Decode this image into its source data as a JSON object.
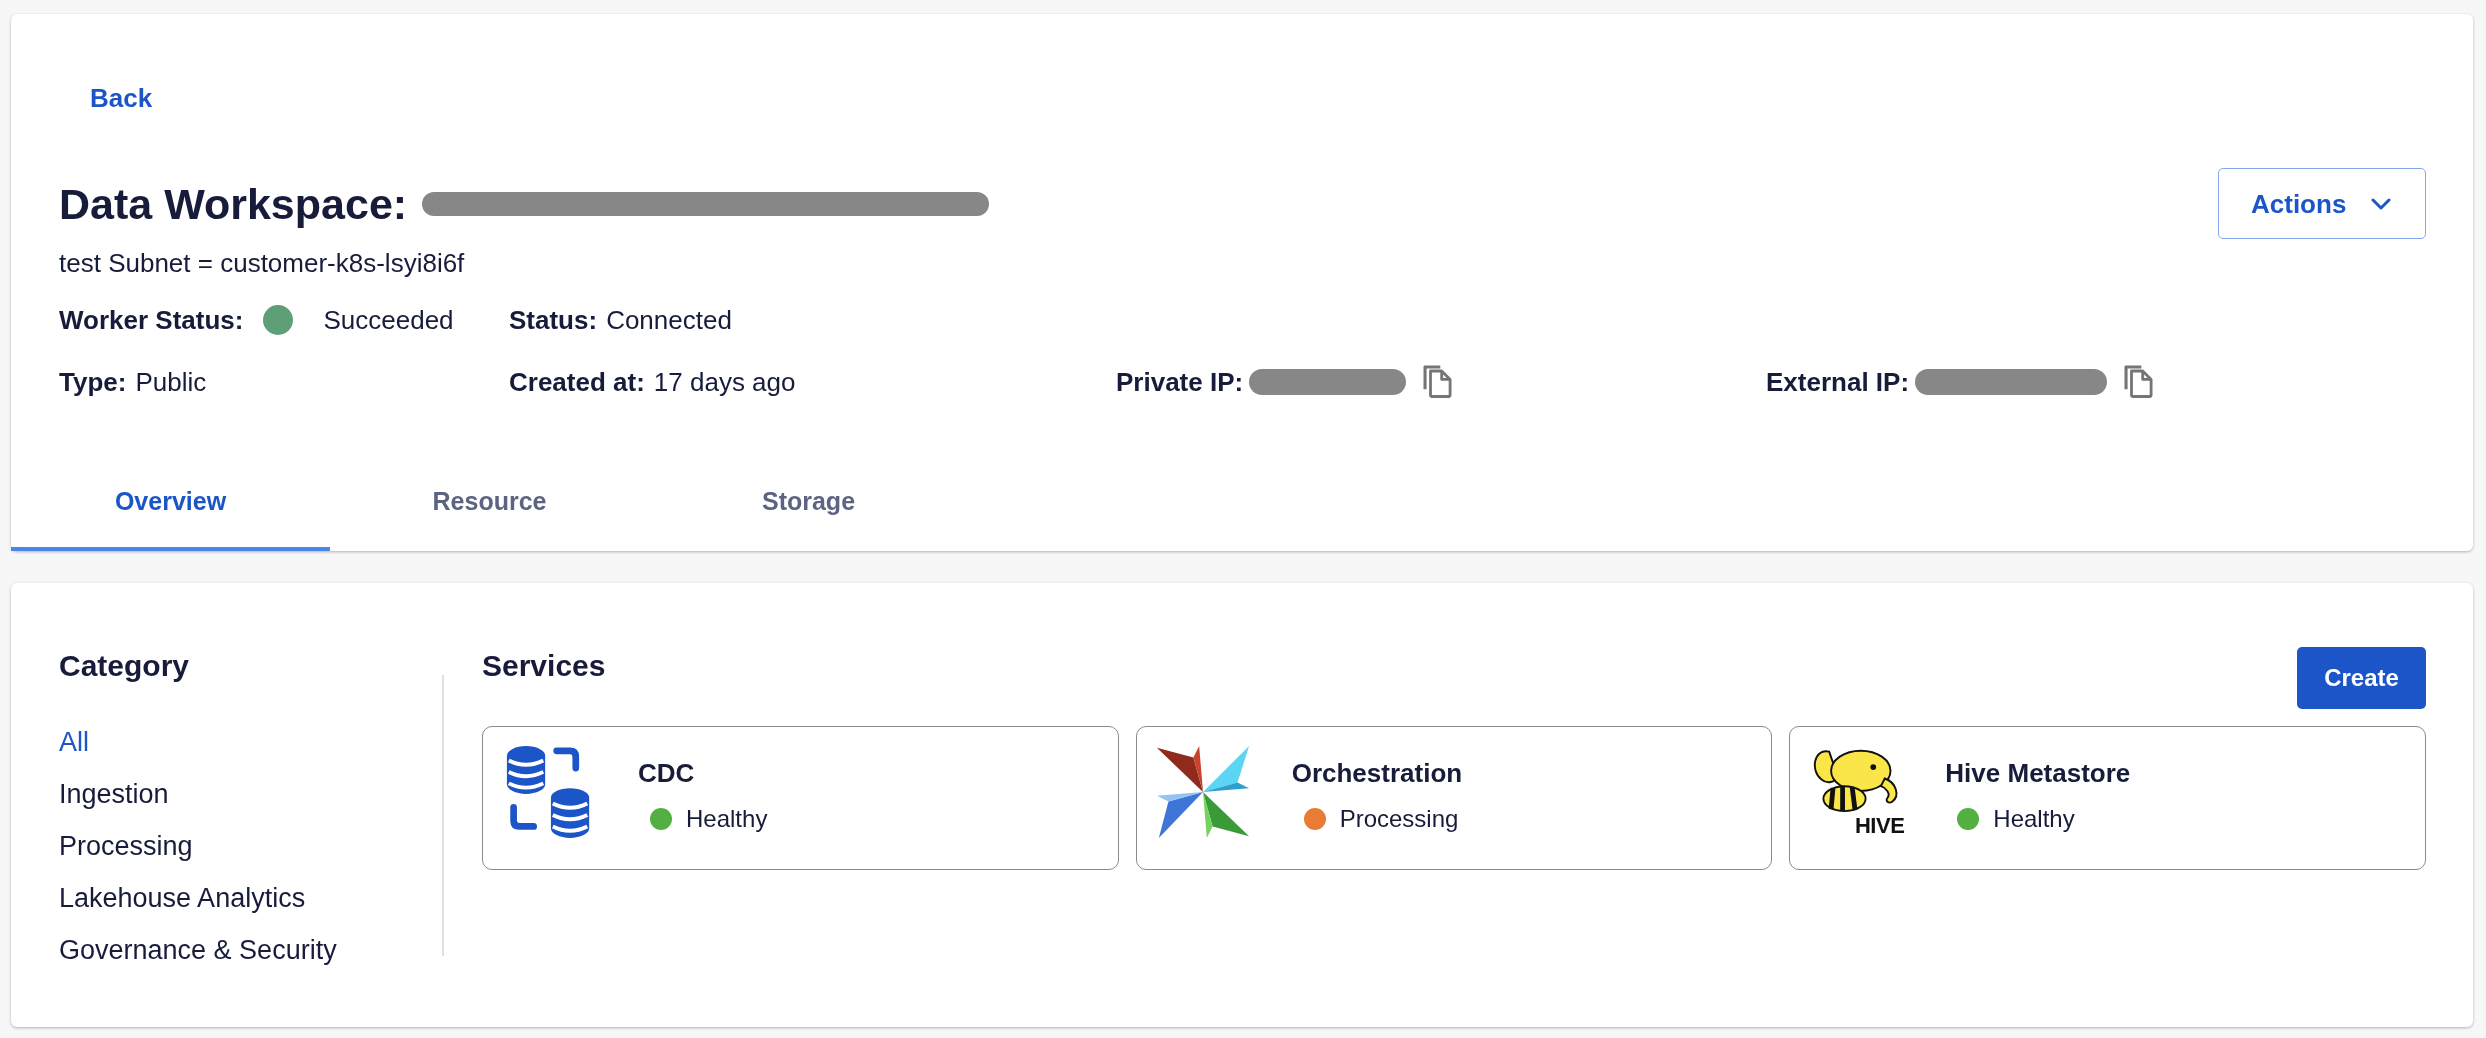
{
  "header": {
    "back_link": "Back",
    "title": "Data Workspace:",
    "name_redacted": true,
    "actions_button": "Actions",
    "subnet": "test Subnet = customer-k8s-lsyi8i6f"
  },
  "detail_rows": [
    {
      "fields": [
        {
          "kind": "status",
          "label": "Worker Status:",
          "value": "Succeeded"
        },
        {
          "kind": "text",
          "label": "Status:",
          "value": "Connected"
        }
      ]
    },
    {
      "fields": [
        {
          "kind": "text",
          "label": "Type:",
          "value": "Public"
        },
        {
          "kind": "text",
          "label": "Created at:",
          "value": "17 days ago"
        },
        {
          "kind": "copy",
          "label": "Private IP:",
          "redacted": true
        },
        {
          "kind": "copy",
          "label": "External IP:",
          "redacted": true
        }
      ]
    }
  ],
  "tabs": [
    {
      "label": "Overview",
      "selected": true
    },
    {
      "label": "Resource",
      "selected": false
    },
    {
      "label": "Storage",
      "selected": false
    }
  ],
  "category": {
    "title": "Category",
    "items": [
      {
        "label": "All",
        "selected": true
      },
      {
        "label": "Ingestion",
        "selected": false
      },
      {
        "label": "Processing",
        "selected": false
      },
      {
        "label": "Lakehouse Analytics",
        "selected": false
      },
      {
        "label": "Governance & Security",
        "selected": false
      }
    ]
  },
  "services": {
    "title": "Services",
    "create_button": "Create",
    "items": [
      {
        "kind": "databases",
        "name": "CDC",
        "status": "Healthy",
        "color": "#52b043"
      },
      {
        "kind": "pinwheel",
        "name": "Orchestration",
        "status": "Processing",
        "color": "#e87c37"
      },
      {
        "kind": "elephant",
        "name": "Hive Metastore",
        "status": "Healthy",
        "color": "#52b043",
        "logo_text": "HIVE"
      }
    ]
  }
}
